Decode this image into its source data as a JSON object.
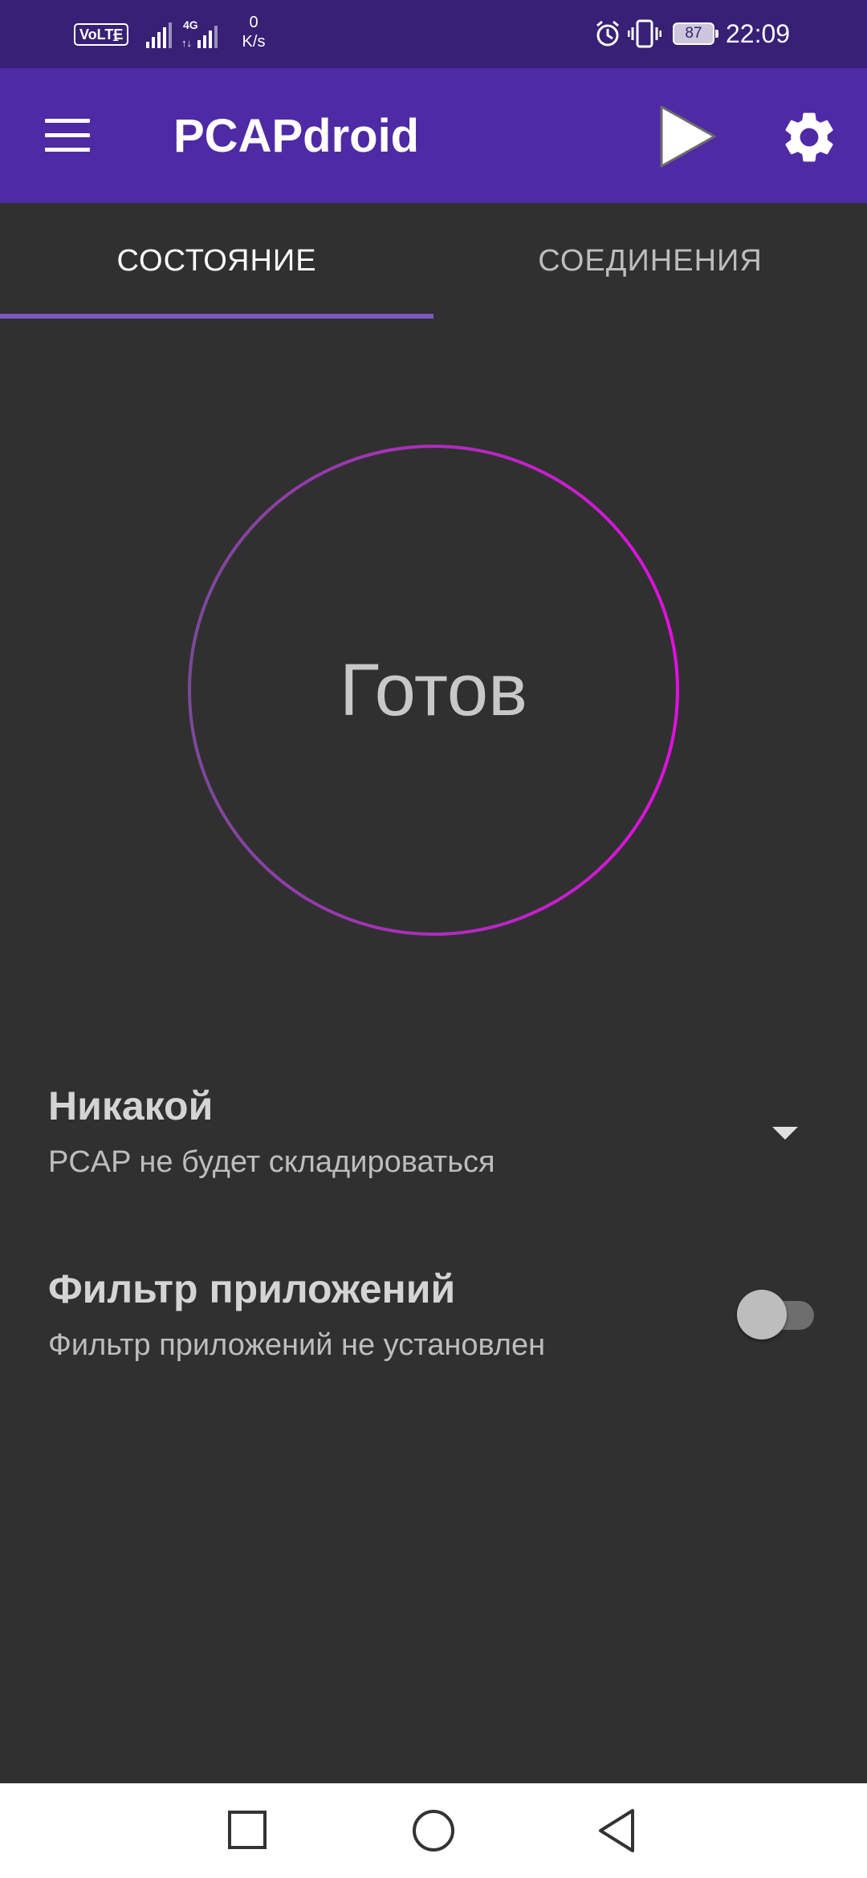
{
  "status_bar": {
    "volte": "VoLTE",
    "sim": "1",
    "network": "4G",
    "speed_value": "0",
    "speed_unit": "K/s",
    "battery": "87",
    "time": "22:09"
  },
  "app_bar": {
    "title": "PCAPdroid",
    "icons": [
      "menu-icon",
      "play-icon",
      "gear-icon"
    ]
  },
  "tabs": [
    {
      "label": "СОСТОЯНИЕ",
      "selected": true
    },
    {
      "label": "СОЕДИНЕНИЯ",
      "selected": false
    }
  ],
  "status": {
    "text": "Готов"
  },
  "dump_mode": {
    "title": "Никакой",
    "subtitle": "PCAP не будет складироваться"
  },
  "app_filter": {
    "title": "Фильтр приложений",
    "subtitle": "Фильтр приложений не установлен",
    "enabled": false
  },
  "nav": {
    "icons": [
      "recents-icon",
      "home-icon",
      "back-icon"
    ]
  },
  "colors": {
    "status_bar": "#372076",
    "app_bar": "#4e2aa4",
    "background": "#303030",
    "tab_indicator": "#7e57c2",
    "circle_gradient_start": "#7a4a98",
    "circle_gradient_end": "#e010e0"
  }
}
